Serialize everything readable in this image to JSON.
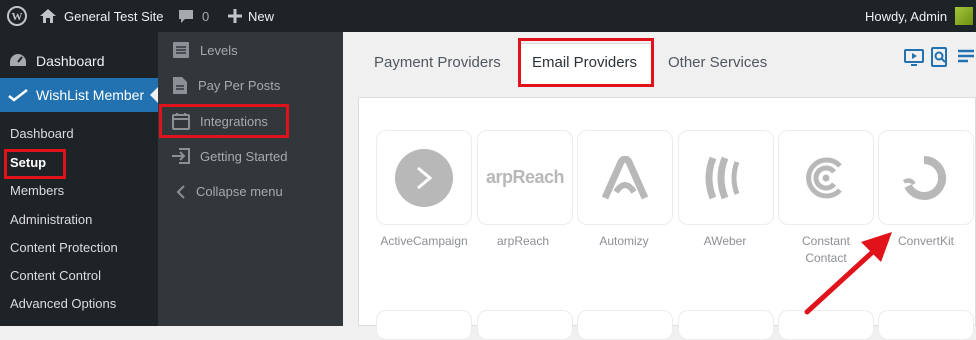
{
  "adminbar": {
    "site_name": "General Test Site",
    "comments_count": "0",
    "new_label": "New",
    "howdy": "Howdy, Admin"
  },
  "menu": {
    "dashboard_top": "Dashboard",
    "plugin_top": "WishList Member",
    "submenu": [
      "Dashboard",
      "Setup",
      "Members",
      "Administration",
      "Content Protection",
      "Content Control",
      "Advanced Options"
    ]
  },
  "flyout": {
    "items": [
      "Levels",
      "Pay Per Posts",
      "Integrations",
      "Getting Started",
      "Collapse menu"
    ]
  },
  "tabs": [
    "Payment Providers",
    "Email Providers",
    "Other Services"
  ],
  "providers": [
    {
      "name": "ActiveCampaign",
      "icon": "activecampaign-icon"
    },
    {
      "name": "arpReach",
      "icon": "arpreach-logo"
    },
    {
      "name": "Automizy",
      "icon": "automizy-icon"
    },
    {
      "name": "AWeber",
      "icon": "aweber-icon"
    },
    {
      "name": "Constant Contact",
      "icon": "constant-contact-icon"
    },
    {
      "name": "ConvertKit",
      "icon": "convertkit-icon"
    }
  ],
  "logos": {
    "arpreach": "arpReach"
  },
  "colors": {
    "accent": "#2271b1",
    "highlight": "#e0131a",
    "adminbar": "#1d2327"
  }
}
